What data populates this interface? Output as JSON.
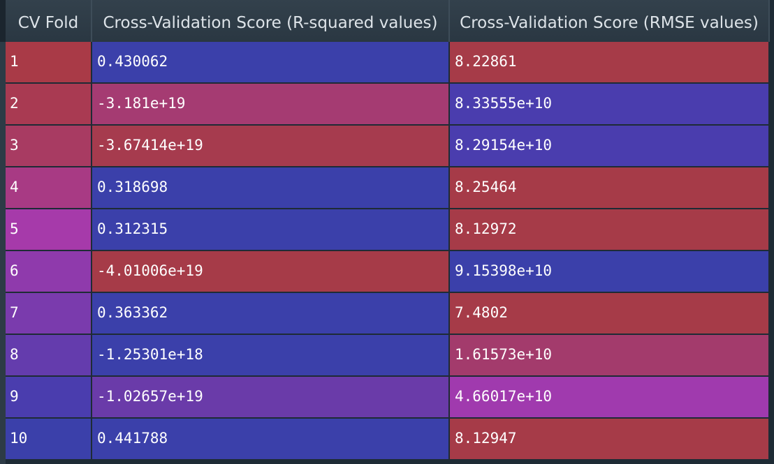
{
  "columns": [
    "CV Fold",
    "Cross-Validation Score (R-squared values)",
    "Cross-Validation Score (RMSE values)"
  ],
  "colors": {
    "red": "#a63b48",
    "blue": "#3b40aa"
  },
  "rows": [
    {
      "fold": "1",
      "r2": "0.430062",
      "rmse": "8.22861",
      "fold_color": "#a93a47",
      "r2_color": "#3b40aa",
      "rmse_color": "#a63b48"
    },
    {
      "fold": "2",
      "r2": "-3.181e+19",
      "rmse": "8.33555e+10",
      "fold_color": "#a93a52",
      "r2_color": "#a53b72",
      "rmse_color": "#4a3dae"
    },
    {
      "fold": "3",
      "r2": "-3.67414e+19",
      "rmse": "8.29154e+10",
      "fold_color": "#a83b62",
      "r2_color": "#a63b4e",
      "rmse_color": "#4a3dae"
    },
    {
      "fold": "4",
      "r2": "0.318698",
      "rmse": "8.25464",
      "fold_color": "#a83a84",
      "r2_color": "#3b40aa",
      "rmse_color": "#a63b48"
    },
    {
      "fold": "5",
      "r2": "0.312315",
      "rmse": "8.12972",
      "fold_color": "#a63aaa",
      "r2_color": "#3b40aa",
      "rmse_color": "#a63b48"
    },
    {
      "fold": "6",
      "r2": "-4.01006e+19",
      "rmse": "9.15398e+10",
      "fold_color": "#8f3aac",
      "r2_color": "#a63b48",
      "rmse_color": "#3b40aa"
    },
    {
      "fold": "7",
      "r2": "0.363362",
      "rmse": "7.4802",
      "fold_color": "#7a3bad",
      "r2_color": "#3b40aa",
      "rmse_color": "#a63b48"
    },
    {
      "fold": "8",
      "r2": "-1.25301e+18",
      "rmse": "1.61573e+10",
      "fold_color": "#643cad",
      "r2_color": "#3b40aa",
      "rmse_color": "#a33b6c"
    },
    {
      "fold": "9",
      "r2": "-1.02657e+19",
      "rmse": "4.66017e+10",
      "fold_color": "#4a3dae",
      "r2_color": "#6a3ba9",
      "rmse_color": "#a03aae"
    },
    {
      "fold": "10",
      "r2": "0.441788",
      "rmse": "8.12947",
      "fold_color": "#3b40aa",
      "r2_color": "#3b40aa",
      "rmse_color": "#a63b48"
    }
  ]
}
